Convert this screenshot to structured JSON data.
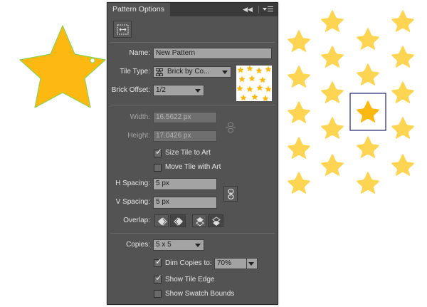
{
  "panel": {
    "title": "Pattern Options",
    "collapse_icon": "double-chevron-left-icon",
    "menu_icon": "panel-menu-icon",
    "tile_tool_icon": "pattern-tile-tool-icon"
  },
  "form": {
    "name_label": "Name:",
    "name_value": "New Pattern",
    "tile_type_label": "Tile Type:",
    "tile_type_value": "Brick by Co...",
    "brick_offset_label": "Brick Offset:",
    "brick_offset_value": "1/2",
    "width_label": "Width:",
    "width_value": "16.5622 px",
    "height_label": "Height:",
    "height_value": "17.0426 px",
    "size_tile_to_art_label": "Size Tile to Art",
    "size_tile_to_art_checked": true,
    "move_tile_with_art_label": "Move Tile with Art",
    "move_tile_with_art_checked": false,
    "h_spacing_label": "H Spacing:",
    "h_spacing_value": "5 px",
    "v_spacing_label": "V Spacing:",
    "v_spacing_value": "5 px",
    "overlap_label": "Overlap:",
    "copies_label": "Copies:",
    "copies_value": "5 x 5",
    "dim_copies_label": "Dim Copies to:",
    "dim_copies_checked": true,
    "dim_copies_value": "70%",
    "show_tile_edge_label": "Show Tile Edge",
    "show_tile_edge_checked": true,
    "show_swatch_bounds_label": "Show Swatch Bounds",
    "show_swatch_bounds_checked": false
  },
  "colors": {
    "star_main": "#FDB912",
    "star_outline": "#8FD14F",
    "star_copy": "#FDD552",
    "tile_edge": "#232370",
    "panel_bg": "#535353"
  }
}
